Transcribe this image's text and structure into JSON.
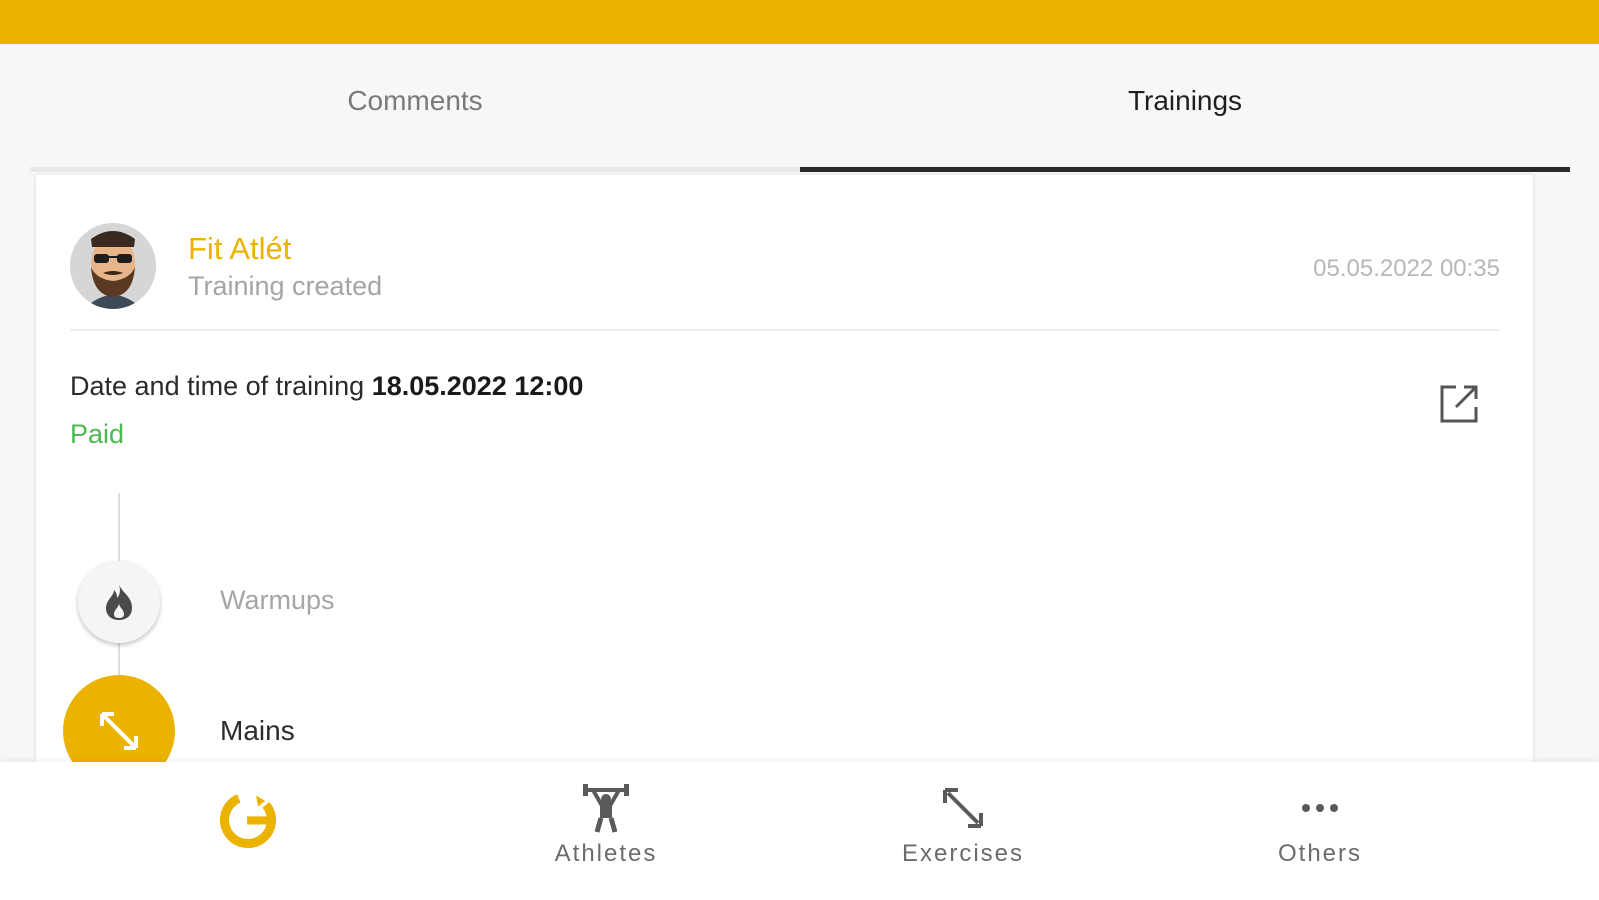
{
  "tabs": [
    {
      "label": "Comments",
      "active": false
    },
    {
      "label": "Trainings",
      "active": true
    }
  ],
  "card": {
    "user_name": "Fit Atlét",
    "subtitle": "Training created",
    "timestamp": "05.05.2022 00:35",
    "date_label": "Date and time of training",
    "date_value": "18.05.2022 12:00",
    "payment_status": "Paid",
    "steps": [
      {
        "label": "Warmups",
        "icon": "flame-icon",
        "state": "inactive"
      },
      {
        "label": "Mains",
        "icon": "expand-arrows-icon",
        "state": "active"
      }
    ]
  },
  "bottom_nav": {
    "items": [
      {
        "label": "",
        "icon": "logo-icon"
      },
      {
        "label": "Athletes",
        "icon": "weightlifter-icon"
      },
      {
        "label": "Exercises",
        "icon": "expand-arrows-icon"
      },
      {
        "label": "Others",
        "icon": "more-dots-icon"
      }
    ]
  },
  "colors": {
    "accent": "#ebb300",
    "paid": "#4cb950",
    "muted_text": "#a5a5a5",
    "active_tab_underline": "#2a2a2a"
  }
}
